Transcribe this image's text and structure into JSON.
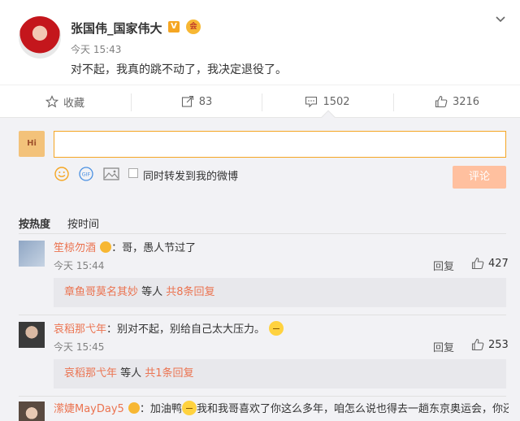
{
  "post": {
    "author": "张国伟_国家伟大",
    "v_badge": "V",
    "vip_badge": "会",
    "time": "今天 15:43",
    "text": "对不起，我真的跳不动了，我决定退役了。"
  },
  "actions": {
    "favorite": "收藏",
    "repost": "83",
    "comment": "1502",
    "like": "3216"
  },
  "composer": {
    "avatar_text": "Hi",
    "input_value": "",
    "repost_label": "同时转发到我的微博",
    "submit_label": "评论"
  },
  "sort": {
    "hot": "按热度",
    "time": "按时间"
  },
  "comments": [
    {
      "name": "笙椋勿酒",
      "text": "：哥，愚人节过了",
      "time": "今天 15:44",
      "reply_label": "回复",
      "likes": "427",
      "sub": {
        "who": "章鱼哥莫名其妙",
        "mid": " 等人 ",
        "count": "共8条回复"
      }
    },
    {
      "name": "哀稻那弋年",
      "text": "：别对不起，别给自己太大压力。",
      "time": "今天 15:45",
      "reply_label": "回复",
      "likes": "253",
      "sub": {
        "who": "哀稻那弋年",
        "mid": " 等人 ",
        "count": "共1条回复"
      }
    },
    {
      "name": "潆婕MayDay5",
      "text_a": "：加油鸭",
      "text_b": "我和我哥喜欢了你这么多年，咱怎么说也得去一趟东京奥运会，你还"
    }
  ],
  "colors": {
    "accent": "#eb7350",
    "brand_orange": "#f5a623",
    "submit_disabled": "#ffc09f",
    "panel_bg": "#f2f2f5"
  }
}
